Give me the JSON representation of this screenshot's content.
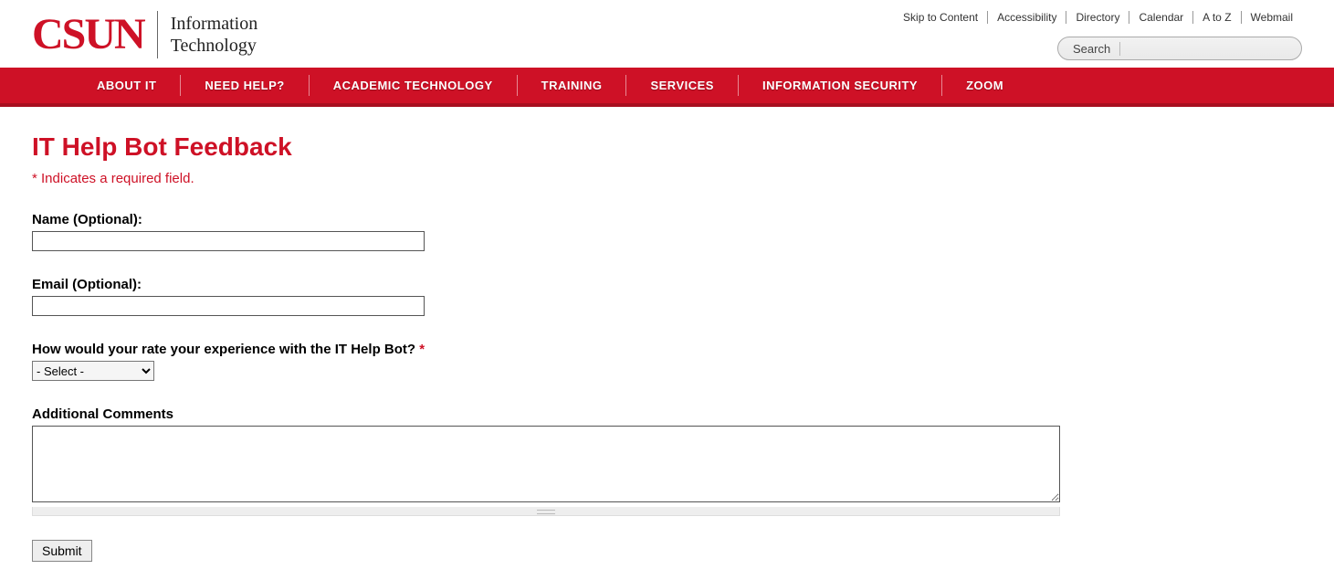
{
  "header": {
    "logo_text": "CSUN",
    "dept_line1": "Information",
    "dept_line2": "Technology"
  },
  "util": {
    "skip": "Skip to Content",
    "accessibility": "Accessibility",
    "directory": "Directory",
    "calendar": "Calendar",
    "atoz": "A to Z",
    "webmail": "Webmail"
  },
  "search": {
    "label": "Search"
  },
  "nav": {
    "about": "ABOUT IT",
    "help": "NEED HELP?",
    "academic": "ACADEMIC TECHNOLOGY",
    "training": "TRAINING",
    "services": "SERVICES",
    "infosec": "INFORMATION SECURITY",
    "zoom": "ZOOM"
  },
  "page": {
    "title": "IT Help Bot Feedback",
    "required_note": "* Indicates a required field."
  },
  "form": {
    "name_label": "Name (Optional):",
    "email_label": "Email (Optional):",
    "rate_label": "How would your rate your experience with the IT Help Bot? ",
    "rate_star": "*",
    "rate_selected": "- Select -",
    "comments_label": "Additional Comments",
    "submit": "Submit"
  }
}
